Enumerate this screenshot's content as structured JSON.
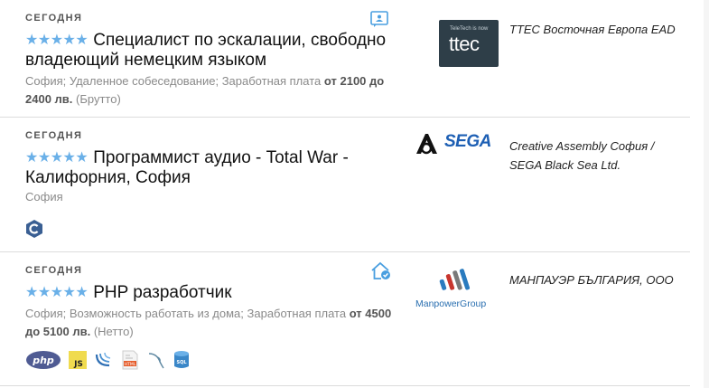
{
  "jobs": [
    {
      "date": "СЕГОДНЯ",
      "stars": "★★★★★",
      "title": "Специалист по эскалации, свободно владеющий немецким языком",
      "meta_plain": "София; Удаленное собеседование; Заработная плата",
      "salary_from_word": "от",
      "salary_range": "2100 до 2400 лв.",
      "salary_type": "(Брутто)",
      "company": "TTEC Восточная Европа EAD",
      "logo_small_text": "TeleTech is now",
      "logo_text": "ttec",
      "badge_icon": "chat-badge-icon",
      "techs": []
    },
    {
      "date": "СЕГОДНЯ",
      "stars": "★★★★★",
      "title": "Программист аудио - Total War - Калифорния, София",
      "meta_plain": "София",
      "company": "Creative Assembly София / SEGA Black Sea Ltd.",
      "logo_text": "SEGA",
      "techs": [
        "cpp-icon"
      ]
    },
    {
      "date": "СЕГОДНЯ",
      "stars": "★★★★★",
      "title": "PHP разработчик",
      "meta_plain": "София; Возможность работать из дома; Заработная плата",
      "salary_from_word": "от",
      "salary_range": "4500 до 5100 лв.",
      "salary_type": "(Нетто)",
      "company": "МАНПАУЭР БЪЛГАРИЯ, ООО",
      "logo_text": "ManpowerGroup",
      "badge_icon": "remote-home-icon",
      "techs": [
        "php-icon",
        "js-icon",
        "jquery-icon",
        "html-icon",
        "mysql-icon",
        "sql-icon"
      ],
      "tech_labels": {
        "php": "php",
        "js": "JS",
        "sql": "SQL",
        "html": "HTML"
      }
    }
  ],
  "colors": {
    "stars": "#6ab0e8",
    "accent": "#4a9fe0",
    "ttec_bg": "#2e3e48",
    "sega_blue": "#1d5fb4"
  }
}
